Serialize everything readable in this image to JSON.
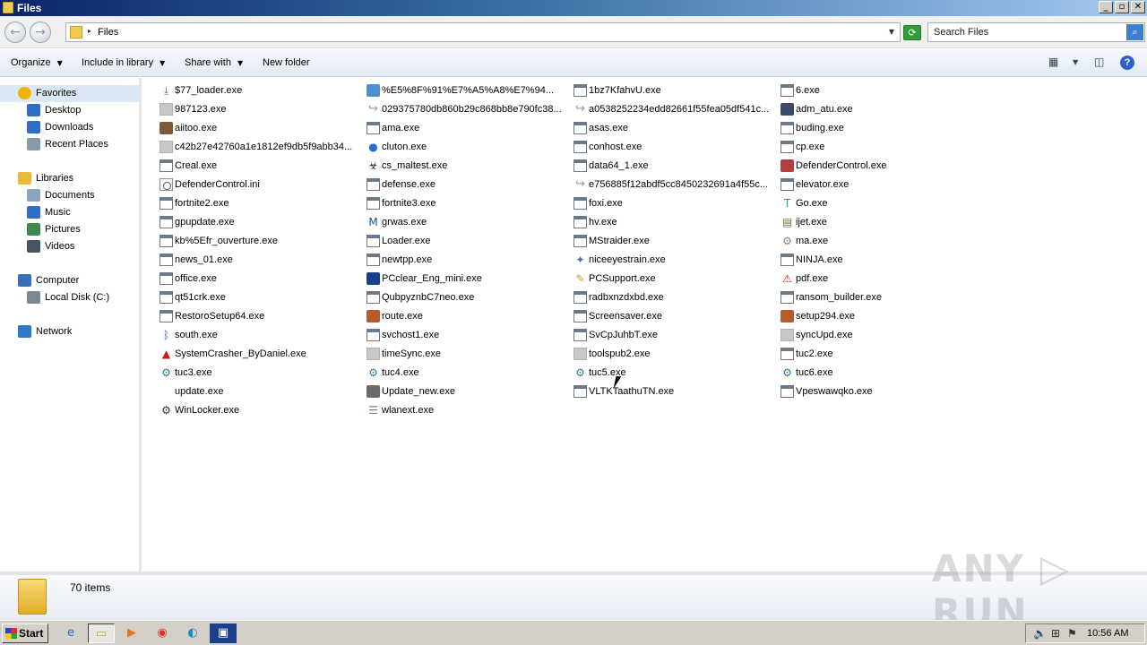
{
  "window": {
    "title": "Files",
    "controls": [
      "_",
      "▫",
      "✕"
    ]
  },
  "address": {
    "crumb": "Files",
    "search_placeholder": "Search Files"
  },
  "toolbar": {
    "organize": "Organize",
    "include": "Include in library",
    "share": "Share with",
    "new_folder": "New folder"
  },
  "nav": [
    {
      "label": "Favorites",
      "icon": "star-icon",
      "color": "#f0b400",
      "level": 0,
      "selected": true
    },
    {
      "label": "Desktop",
      "icon": "desktop-icon",
      "color": "#2f6fc5",
      "level": 1
    },
    {
      "label": "Downloads",
      "icon": "downloads-folder-icon",
      "color": "#2f6fc5",
      "level": 1
    },
    {
      "label": "Recent Places",
      "icon": "recent-places-icon",
      "color": "#8899aa",
      "level": 1
    },
    {
      "label": "Libraries",
      "icon": "libraries-icon",
      "color": "#e8b93a",
      "level": 0
    },
    {
      "label": "Documents",
      "icon": "documents-icon",
      "color": "#8ca3bd",
      "level": 1
    },
    {
      "label": "Music",
      "icon": "music-icon",
      "color": "#2f6fc5",
      "level": 1
    },
    {
      "label": "Pictures",
      "icon": "pictures-icon",
      "color": "#3d8a4a",
      "level": 1
    },
    {
      "label": "Videos",
      "icon": "videos-icon",
      "color": "#445566",
      "level": 1
    },
    {
      "label": "Computer",
      "icon": "computer-icon",
      "color": "#3a6fb8",
      "level": 0
    },
    {
      "label": "Local Disk (C:)",
      "icon": "local-disk-icon",
      "color": "#7a8794",
      "level": 1
    },
    {
      "label": "Network",
      "icon": "network-icon",
      "color": "#2f7ac5",
      "level": 0
    }
  ],
  "files": [
    {
      "name": "$77_loader.exe",
      "icon": "installer-icon",
      "kind": "glyph",
      "glyph": "⤓",
      "color": "#4a8a3a"
    },
    {
      "name": "987123.exe",
      "icon": "blank-icon",
      "kind": "blank"
    },
    {
      "name": "aiitoo.exe",
      "icon": "app-photo-icon",
      "kind": "color",
      "color": "#7b5a3a"
    },
    {
      "name": "c42b27e42760a1e1812ef9db5f9abb34...",
      "icon": "blank-doc-icon",
      "kind": "blank"
    },
    {
      "name": "Creal.exe",
      "icon": "exe-icon",
      "kind": "exe"
    },
    {
      "name": "DefenderControl.ini",
      "icon": "settings-file-icon",
      "kind": "ini"
    },
    {
      "name": "fortnite2.exe",
      "icon": "exe-icon",
      "kind": "exe"
    },
    {
      "name": "gpupdate.exe",
      "icon": "exe-icon",
      "kind": "exe"
    },
    {
      "name": "kb%5Efr_ouverture.exe",
      "icon": "exe-icon",
      "kind": "exe"
    },
    {
      "name": "news_01.exe",
      "icon": "exe-icon",
      "kind": "exe"
    },
    {
      "name": "office.exe",
      "icon": "exe-icon",
      "kind": "exe"
    },
    {
      "name": "qt51crk.exe",
      "icon": "exe-icon",
      "kind": "exe"
    },
    {
      "name": "RestoroSetup64.exe",
      "icon": "exe-icon",
      "kind": "exe"
    },
    {
      "name": "south.exe",
      "icon": "bluetooth-icon",
      "kind": "glyph",
      "glyph": "ᛒ",
      "color": "#1f5fc8"
    },
    {
      "name": "SystemCrasher_ByDaniel.exe",
      "icon": "warning-icon",
      "kind": "glyph",
      "glyph": "▲",
      "color": "#d01818"
    },
    {
      "name": "tuc3.exe",
      "icon": "setup-icon",
      "kind": "glyph",
      "glyph": "⚙",
      "color": "#3a7a9a"
    },
    {
      "name": "update.exe",
      "icon": "none-icon",
      "kind": "none"
    },
    {
      "name": "WinLocker.exe",
      "icon": "gears-icon",
      "kind": "glyph",
      "glyph": "⚙",
      "color": "#333333"
    },
    {
      "name": "%E5%8F%91%E7%A5%A8%E7%94...",
      "icon": "image-file-icon",
      "kind": "color",
      "color": "#4d8fd1"
    },
    {
      "name": "029375780db860b29c868bb8e790fc38...",
      "icon": "shortcut-icon",
      "kind": "short"
    },
    {
      "name": "ama.exe",
      "icon": "exe-icon",
      "kind": "exe"
    },
    {
      "name": "cluton.exe",
      "icon": "globe-icon",
      "kind": "glyph",
      "glyph": "●",
      "color": "#2a6fc9"
    },
    {
      "name": "cs_maltest.exe",
      "icon": "biohazard-icon",
      "kind": "glyph",
      "glyph": "☣",
      "color": "#222222"
    },
    {
      "name": "defense.exe",
      "icon": "exe-icon",
      "kind": "exe"
    },
    {
      "name": "fortnite3.exe",
      "icon": "exe-icon",
      "kind": "exe"
    },
    {
      "name": "grwas.exe",
      "icon": "m-logo-icon",
      "kind": "glyph",
      "glyph": "M",
      "color": "#1f4f9a"
    },
    {
      "name": "Loader.exe",
      "icon": "exe-icon",
      "kind": "exe"
    },
    {
      "name": "newtpp.exe",
      "icon": "exe-icon",
      "kind": "exe"
    },
    {
      "name": "PCclear_Eng_mini.exe",
      "icon": "pcclear-icon",
      "kind": "color",
      "color": "#1a3f8a"
    },
    {
      "name": "QubpyznbC7neo.exe",
      "icon": "exe-icon",
      "kind": "exe"
    },
    {
      "name": "route.exe",
      "icon": "archive-icon",
      "kind": "color",
      "color": "#b85a2a"
    },
    {
      "name": "svchost1.exe",
      "icon": "exe-icon",
      "kind": "exe"
    },
    {
      "name": "timeSync.exe",
      "icon": "blank-icon",
      "kind": "blank"
    },
    {
      "name": "tuc4.exe",
      "icon": "setup-icon",
      "kind": "glyph",
      "glyph": "⚙",
      "color": "#3a7a9a"
    },
    {
      "name": "Update_new.exe",
      "icon": "package-icon",
      "kind": "color",
      "color": "#6a6a6a"
    },
    {
      "name": "wlanext.exe",
      "icon": "list-file-icon",
      "kind": "glyph",
      "glyph": "☰",
      "color": "#6a8a6a"
    },
    {
      "name": "1bz7KfahvU.exe",
      "icon": "exe-icon",
      "kind": "exe"
    },
    {
      "name": "a0538252234edd82661f55fea05df541c...",
      "icon": "shortcut-icon",
      "kind": "short"
    },
    {
      "name": "asas.exe",
      "icon": "exe-icon",
      "kind": "exe"
    },
    {
      "name": "conhost.exe",
      "icon": "exe-icon",
      "kind": "exe"
    },
    {
      "name": "data64_1.exe",
      "icon": "exe-icon",
      "kind": "exe"
    },
    {
      "name": "e756885f12abdf5cc8450232691a4f55c...",
      "icon": "shortcut-icon",
      "kind": "short"
    },
    {
      "name": "foxi.exe",
      "icon": "exe-icon",
      "kind": "exe"
    },
    {
      "name": "hv.exe",
      "icon": "exe-icon",
      "kind": "exe"
    },
    {
      "name": "MStraider.exe",
      "icon": "exe-icon",
      "kind": "exe"
    },
    {
      "name": "niceeyestrain.exe",
      "icon": "eye-icon",
      "kind": "glyph",
      "glyph": "✦",
      "color": "#4a6fb0"
    },
    {
      "name": "PCSupport.exe",
      "icon": "magnifier-icon",
      "kind": "glyph",
      "glyph": "✎",
      "color": "#d09a20"
    },
    {
      "name": "radbxnzdxbd.exe",
      "icon": "exe-icon",
      "kind": "exe"
    },
    {
      "name": "Screensaver.exe",
      "icon": "exe-icon",
      "kind": "exe"
    },
    {
      "name": "SvCpJuhbT.exe",
      "icon": "exe-icon",
      "kind": "exe"
    },
    {
      "name": "toolspub2.exe",
      "icon": "blank-icon",
      "kind": "blank"
    },
    {
      "name": "tuc5.exe",
      "icon": "setup-icon",
      "kind": "glyph",
      "glyph": "⚙",
      "color": "#3a7a9a"
    },
    {
      "name": "VLTKTaathuTN.exe",
      "icon": "exe-icon",
      "kind": "exe"
    },
    {
      "name": "6.exe",
      "icon": "exe-icon",
      "kind": "exe"
    },
    {
      "name": "adm_atu.exe",
      "icon": "box-icon",
      "kind": "color",
      "color": "#3a4a6a"
    },
    {
      "name": "buding.exe",
      "icon": "exe-icon",
      "kind": "exe"
    },
    {
      "name": "cp.exe",
      "icon": "exe-icon",
      "kind": "exe"
    },
    {
      "name": "DefenderControl.exe",
      "icon": "shield-icon",
      "kind": "color",
      "color": "#b04040"
    },
    {
      "name": "elevator.exe",
      "icon": "exe-icon",
      "kind": "exe"
    },
    {
      "name": "Go.exe",
      "icon": "t-logo-icon",
      "kind": "glyph",
      "glyph": "T",
      "color": "#2aa84a"
    },
    {
      "name": "ijet.exe",
      "icon": "document-icon",
      "kind": "glyph",
      "glyph": "▤",
      "color": "#6a7a4a"
    },
    {
      "name": "ma.exe",
      "icon": "gear-icon",
      "kind": "glyph",
      "glyph": "⚙",
      "color": "#888888"
    },
    {
      "name": "NINJA.exe",
      "icon": "exe-icon",
      "kind": "exe"
    },
    {
      "name": "pdf.exe",
      "icon": "pdf-icon",
      "kind": "glyph",
      "glyph": "⚠",
      "color": "#c02020"
    },
    {
      "name": "ransom_builder.exe",
      "icon": "exe-icon",
      "kind": "exe"
    },
    {
      "name": "setup294.exe",
      "icon": "archive-icon",
      "kind": "color",
      "color": "#b85a2a"
    },
    {
      "name": "syncUpd.exe",
      "icon": "blank-icon",
      "kind": "blank"
    },
    {
      "name": "tuc2.exe",
      "icon": "exe-icon",
      "kind": "exe"
    },
    {
      "name": "tuc6.exe",
      "icon": "setup-icon",
      "kind": "glyph",
      "glyph": "⚙",
      "color": "#3a7a9a"
    },
    {
      "name": "Vpeswawqko.exe",
      "icon": "exe-icon",
      "kind": "exe"
    }
  ],
  "status": {
    "count": "70 items"
  },
  "watermark": "ANY ▷ RUN",
  "taskbar": {
    "start": "Start",
    "clock": "10:56 AM"
  }
}
